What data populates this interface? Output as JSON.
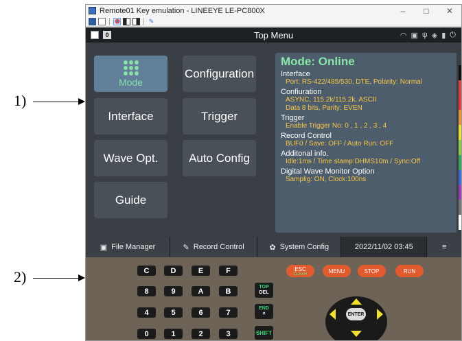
{
  "callouts": {
    "c1": "1)",
    "c2": "2)"
  },
  "window": {
    "title": "Remote01 Key emulation - LINEEYE LE-PC800X",
    "minimize": "–",
    "maximize": "□",
    "close": "✕"
  },
  "toolbar": {
    "icons": [
      "save-icon",
      "copy-icon",
      "remote-icon",
      "view-left-icon",
      "view-right-icon",
      "pen-icon"
    ]
  },
  "header": {
    "title": "Top Menu",
    "badge": "0",
    "icons": [
      "wifi-icon",
      "network-icon",
      "usb-icon",
      "tag-icon",
      "sd-card-icon",
      "power-icon"
    ]
  },
  "menu": {
    "mode": "Mode",
    "configuration": "Configuration",
    "interface": "Interface",
    "trigger": "Trigger",
    "wave_opt": "Wave Opt.",
    "auto_config": "Auto Config",
    "guide": "Guide"
  },
  "info": {
    "mode_title": "Mode: Online",
    "sections": [
      {
        "title": "Interface",
        "lines": [
          "Port: RS-422/485/530, DTE, Polarity: Normal"
        ]
      },
      {
        "title": "Confiuration",
        "lines": [
          "ASYNC, 115.2k/115.2k, ASCII",
          "Data 8 bits, Parity: EVEN"
        ]
      },
      {
        "title": "Trigger",
        "lines": [
          "Enable Trigger No: 0 , 1 , 2 , 3 , 4"
        ]
      },
      {
        "title": "Record Control",
        "lines": [
          "BUF0 / Save: OFF / Auto Run: OFF"
        ]
      },
      {
        "title": "Additonal info.",
        "lines": [
          "Idle:1ms / Time stamp:DHMS10m / Sync:Off"
        ]
      },
      {
        "title": "Digital Wave Monitor Option",
        "lines": [
          "Samplig: ON, Clock:100ns"
        ]
      }
    ]
  },
  "swatches": [
    "#111111",
    "#d64545",
    "#e03c3c",
    "#e8923a",
    "#e8e03a",
    "#8cc84b",
    "#35a85a",
    "#3a6fd6",
    "#9a3fb8",
    "#777777",
    "#ffffff"
  ],
  "bottom": {
    "file_manager": "File Manager",
    "record_control": "Record Control",
    "system_config": "System Config",
    "datetime": "2022/11/02 03:45"
  },
  "keypad": {
    "rows": [
      [
        "C",
        "D",
        "E",
        "F"
      ],
      [
        "8",
        "9",
        "A",
        "B"
      ],
      [
        "4",
        "5",
        "6",
        "7"
      ],
      [
        "0",
        "1",
        "2",
        "3"
      ]
    ],
    "top_del": {
      "top": "TOP",
      "bottom": "DEL"
    },
    "end_x": {
      "top": "END",
      "bottom": "×"
    },
    "shift": "SHIFT",
    "esc": {
      "label": "ESC",
      "sub": "CLEAR"
    },
    "menu": "MENU",
    "stop": "STOP",
    "run": "RUN",
    "enter": "ENTER"
  },
  "colors": {
    "accent_green": "#86e0a8",
    "value_yellow": "#f7c74a",
    "orange_key": "#e15b2f"
  }
}
